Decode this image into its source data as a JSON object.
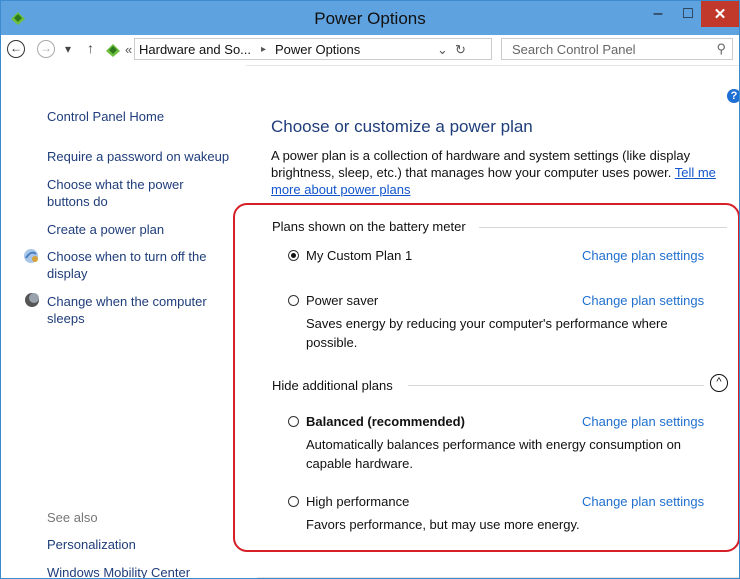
{
  "window": {
    "title": "Power Options"
  },
  "controls": {
    "minimize": "–",
    "maximize": "□",
    "close": "✕"
  },
  "nav": {
    "back": "←",
    "forward": "→",
    "dropdown": "▾",
    "up": "↑",
    "breadcrumb_prefix": "«",
    "crumb1": "Hardware and So...",
    "sep": "▸",
    "crumb2": "Power Options",
    "addr_dropdown": "⌄",
    "refresh": "↻",
    "search_placeholder": "Search Control Panel",
    "search_icon": "⚲"
  },
  "sidebar": {
    "home": "Control Panel Home",
    "require_password": "Require a password on wakeup",
    "choose_power_buttons": [
      "Choose what the power",
      "buttons do"
    ],
    "create_plan": "Create a power plan",
    "turn_off_display": [
      "Choose when to turn off the",
      "display"
    ],
    "computer_sleeps": [
      "Change when the computer",
      "sleeps"
    ],
    "see_also": "See also",
    "personalization": "Personalization",
    "mobility_center": "Windows Mobility Center"
  },
  "main": {
    "help": "?",
    "heading": "Choose or customize a power plan",
    "description_lines": [
      "A power plan is a collection of hardware and system settings (like display",
      "brightness, sleep, etc.) that manages how your computer uses power."
    ],
    "tell_me_1": "Tell me",
    "tell_me_2": "more about power plans",
    "battery_section": "Plans shown on the battery meter",
    "additional_section": "Hide additional plans",
    "change_label": "Change plan settings",
    "plans": {
      "custom": {
        "name": "My Custom Plan 1",
        "selected": true
      },
      "saver": {
        "name": "Power saver",
        "desc": [
          "Saves energy by reducing your computer's performance where",
          "possible."
        ]
      },
      "balanced": {
        "name": "Balanced (recommended)",
        "desc": [
          "Automatically balances performance with energy consumption on",
          "capable hardware."
        ]
      },
      "high": {
        "name": "High performance",
        "desc": [
          "Favors performance, but may use more energy."
        ]
      }
    }
  },
  "colors": {
    "accent": "#5fa2e0",
    "link": "#1f6fcf",
    "highlight_border": "#d61f26",
    "close": "#c0392b"
  }
}
